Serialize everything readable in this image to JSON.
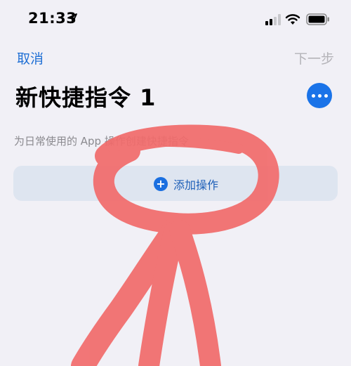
{
  "status_bar": {
    "time": "21:33",
    "icons": [
      "location-arrow-icon",
      "signal-icon",
      "wifi-icon",
      "battery-icon"
    ]
  },
  "nav": {
    "cancel_label": "取消",
    "next_label": "下一步"
  },
  "shortcut": {
    "title": "新快捷指令 1",
    "more_icon": "ellipsis-icon",
    "description": "为日常使用的 App 操作创建快捷指令"
  },
  "add_action": {
    "icon": "plus-circle-icon",
    "label": "添加操作"
  },
  "colors": {
    "accent": "#1a73e8",
    "link": "#1f6fd4",
    "disabled": "#b4b3b8",
    "background": "#f1f0f6",
    "card": "#dee5f0",
    "annotation": "#f26b6b"
  }
}
